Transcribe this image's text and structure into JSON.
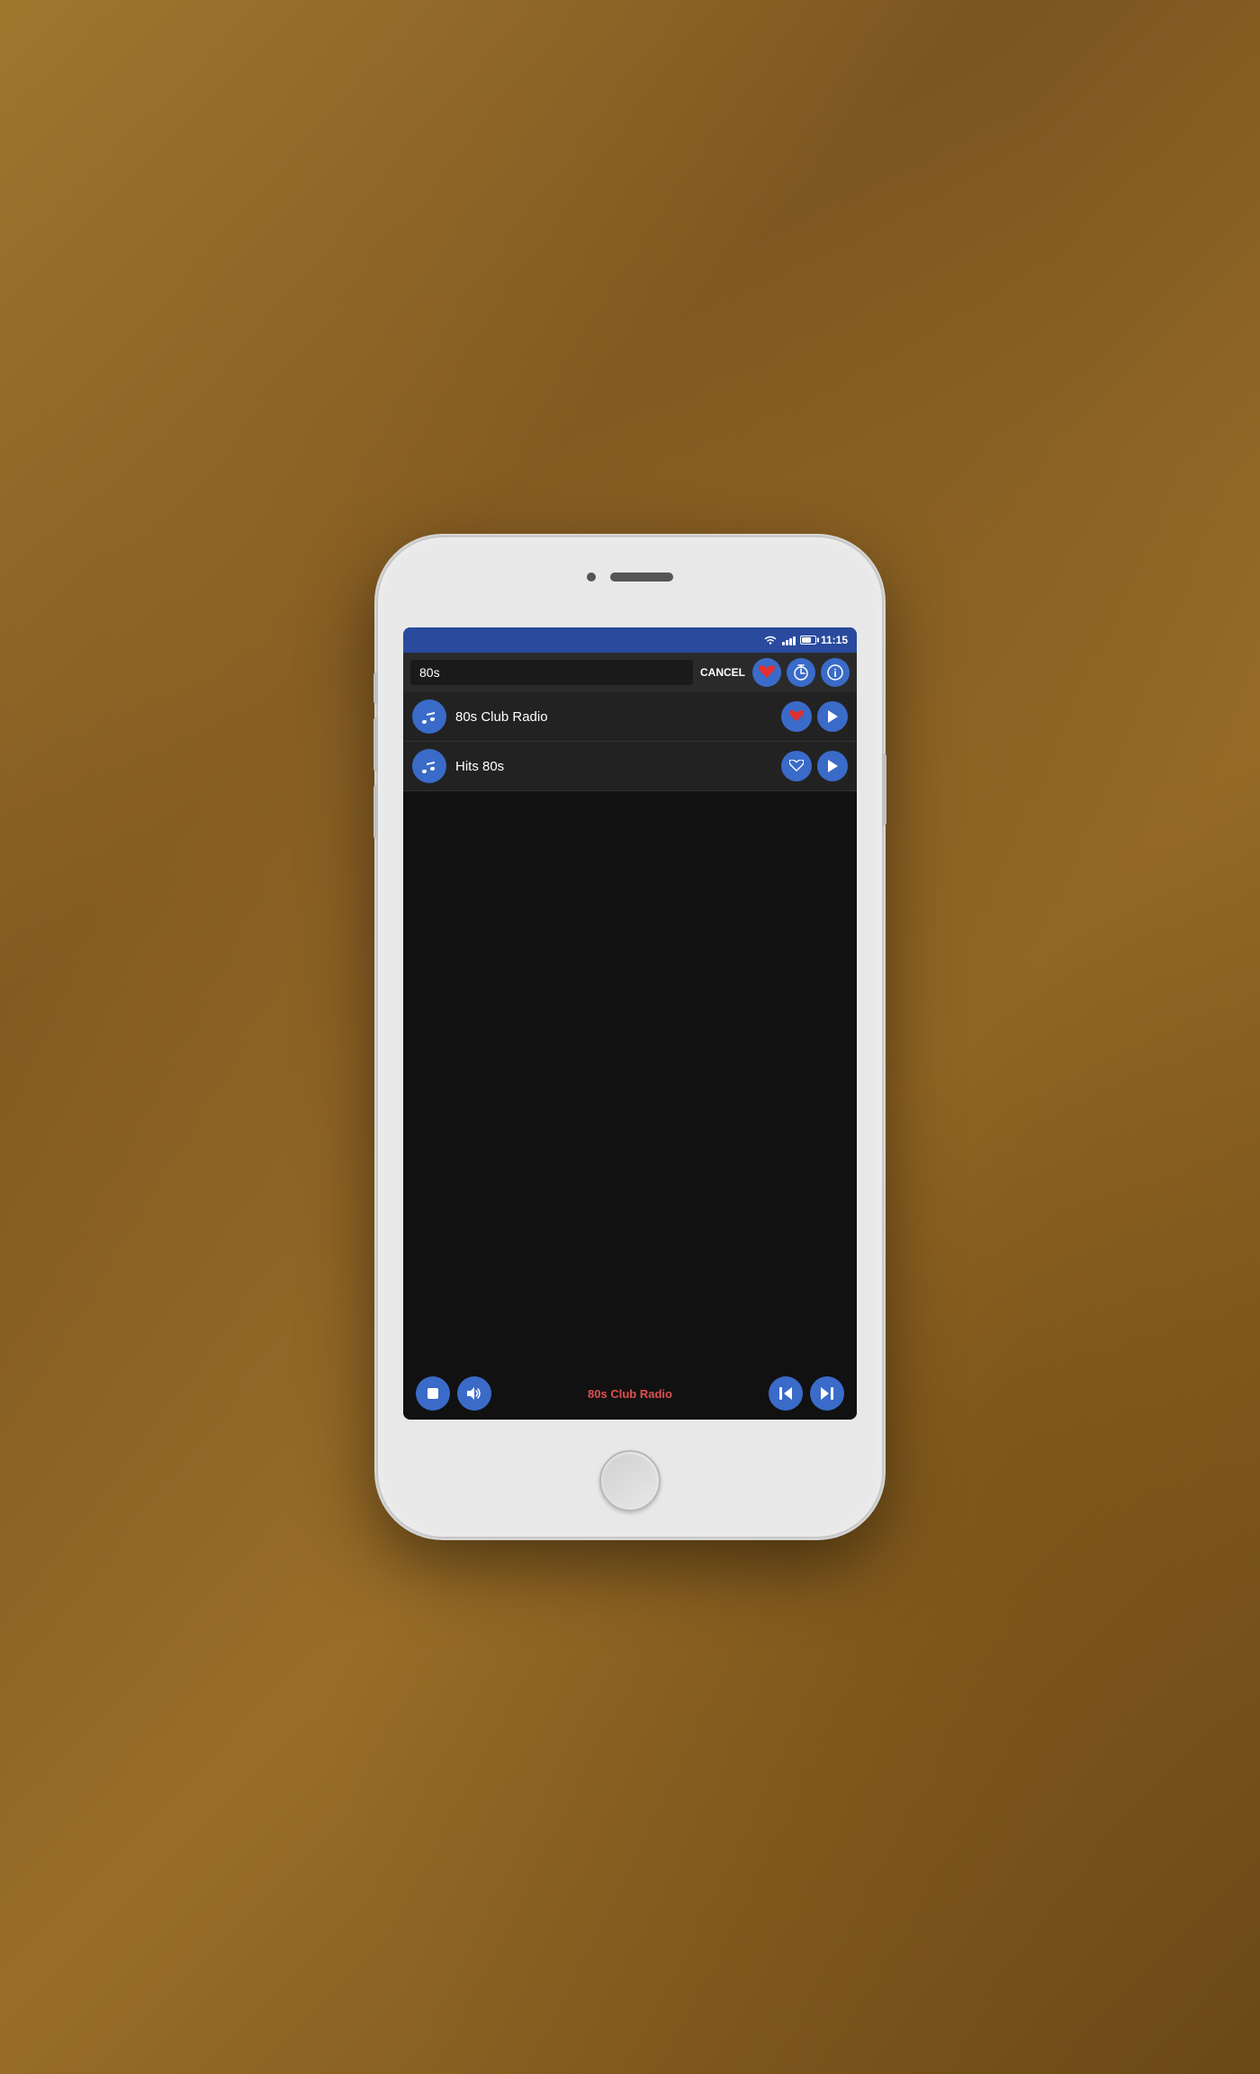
{
  "status_bar": {
    "time": "11:15"
  },
  "search": {
    "query": "80s",
    "cancel_label": "CANCEL"
  },
  "toolbar": {
    "heart_icon": "heart-icon",
    "timer_icon": "timer-icon",
    "info_icon": "info-icon"
  },
  "stations": [
    {
      "id": 1,
      "name": "80s Club Radio",
      "favorited": true
    },
    {
      "id": 2,
      "name": "Hits 80s",
      "favorited": false
    }
  ],
  "bottom_bar": {
    "now_playing": "80s Club Radio",
    "stop_icon": "stop-icon",
    "volume_icon": "volume-icon",
    "prev_icon": "prev-icon",
    "next_icon": "next-icon"
  }
}
